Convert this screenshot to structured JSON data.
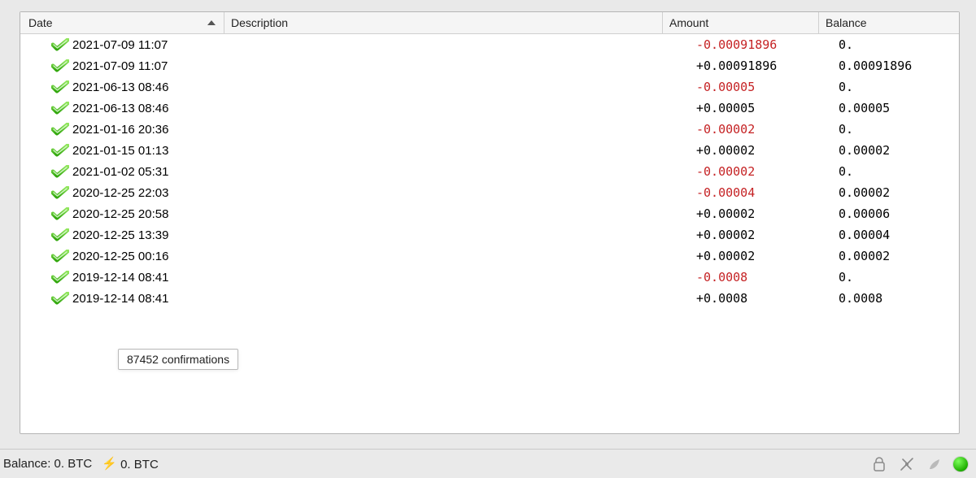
{
  "columns": {
    "date": "Date",
    "description": "Description",
    "amount": "Amount",
    "balance": "Balance"
  },
  "sort": {
    "column": "date",
    "direction": "asc_indicator"
  },
  "transactions": [
    {
      "date": "2021-07-09 11:07",
      "description": "",
      "amount": "-0.00091896",
      "amount_sign": "neg",
      "balance": "0."
    },
    {
      "date": "2021-07-09 11:07",
      "description": "",
      "amount": "+0.00091896",
      "amount_sign": "pos",
      "balance": "0.00091896"
    },
    {
      "date": "2021-06-13 08:46",
      "description": "",
      "amount": "-0.00005",
      "amount_sign": "neg",
      "balance": "0."
    },
    {
      "date": "2021-06-13 08:46",
      "description": "",
      "amount": "+0.00005",
      "amount_sign": "pos",
      "balance": "0.00005"
    },
    {
      "date": "2021-01-16 20:36",
      "description": "",
      "amount": "-0.00002",
      "amount_sign": "neg",
      "balance": "0."
    },
    {
      "date": "2021-01-15 01:13",
      "description": "",
      "amount": "+0.00002",
      "amount_sign": "pos",
      "balance": "0.00002"
    },
    {
      "date": "2021-01-02 05:31",
      "description": "",
      "amount": "-0.00002",
      "amount_sign": "neg",
      "balance": "0."
    },
    {
      "date": "2020-12-25 22:03",
      "description": "",
      "amount": "-0.00004",
      "amount_sign": "neg",
      "balance": "0.00002"
    },
    {
      "date": "2020-12-25 20:58",
      "description": "",
      "amount": "+0.00002",
      "amount_sign": "pos",
      "balance": "0.00006"
    },
    {
      "date": "2020-12-25 13:39",
      "description": "",
      "amount": "+0.00002",
      "amount_sign": "pos",
      "balance": "0.00004"
    },
    {
      "date": "2020-12-25 00:16",
      "description": "",
      "amount": "+0.00002",
      "amount_sign": "pos",
      "balance": "0.00002"
    },
    {
      "date": "2019-12-14 08:41",
      "description": "",
      "amount": "-0.0008",
      "amount_sign": "neg",
      "balance": "0."
    },
    {
      "date": "2019-12-14 08:41",
      "description": "",
      "amount": "+0.0008",
      "amount_sign": "pos",
      "balance": "0.0008"
    }
  ],
  "tooltip": "87452 confirmations",
  "statusbar": {
    "balance_label": "Balance:",
    "balance_value": "0. BTC",
    "lightning_value": "0. BTC"
  },
  "icons": {
    "confirmed": "confirmed-check-icon",
    "lock": "lock-icon",
    "tools": "tools-icon",
    "seed": "seed-icon",
    "network": "network-status-icon"
  }
}
